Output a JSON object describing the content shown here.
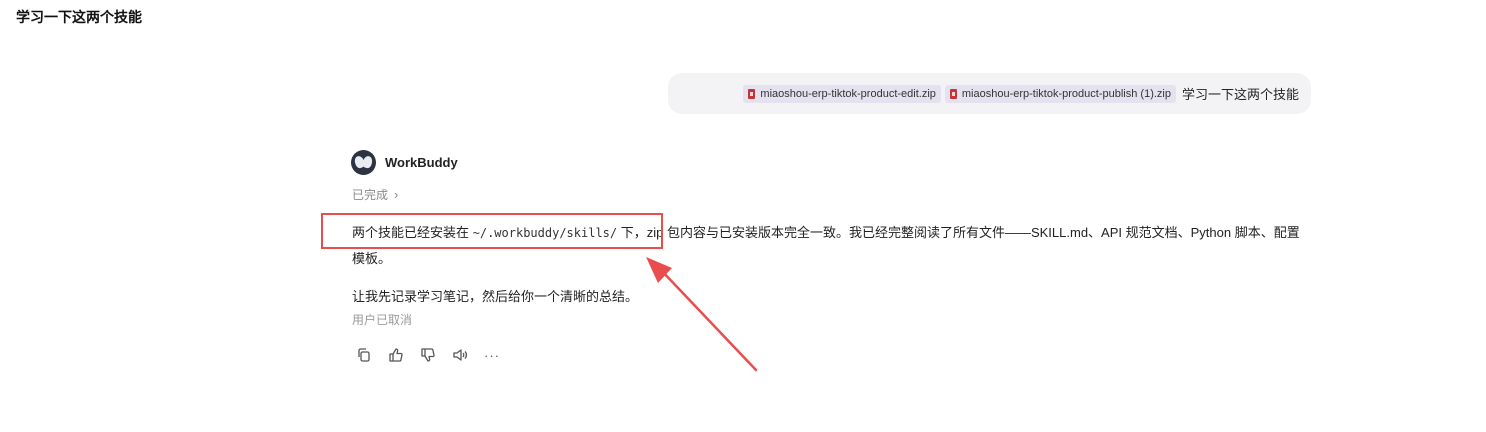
{
  "page": {
    "title": "学习一下这两个技能"
  },
  "user_message": {
    "attachments": [
      {
        "name": "miaoshou-erp-tiktok-product-edit.zip",
        "icon": "zip-file-icon"
      },
      {
        "name": "miaoshou-erp-tiktok-product-publish (1).zip",
        "icon": "zip-file-icon"
      }
    ],
    "text": "学习一下这两个技能"
  },
  "assistant": {
    "name": "WorkBuddy",
    "status": "已完成",
    "paragraph1": {
      "before": "两个技能已经安装在 ",
      "code": "~/.workbuddy/skills/",
      "after": " 下，zip 包内容与已安装版本完全一致。我已经完整阅读了所有文件——SKILL.md、API 规范文档、Python 脚本、配置模板。"
    },
    "paragraph2": "让我先记录学习笔记，然后给你一个清晰的总结。",
    "cancel_note": "用户已取消"
  },
  "actions": [
    "copy-icon",
    "thumbs-up-icon",
    "thumbs-down-icon",
    "speaker-icon",
    "more-icon"
  ],
  "colors": {
    "highlight": "#ea4d4d",
    "bubble_bg": "#f3f3f5",
    "chip_bg": "#e5e2ef",
    "zip_icon": "#c6343b"
  }
}
